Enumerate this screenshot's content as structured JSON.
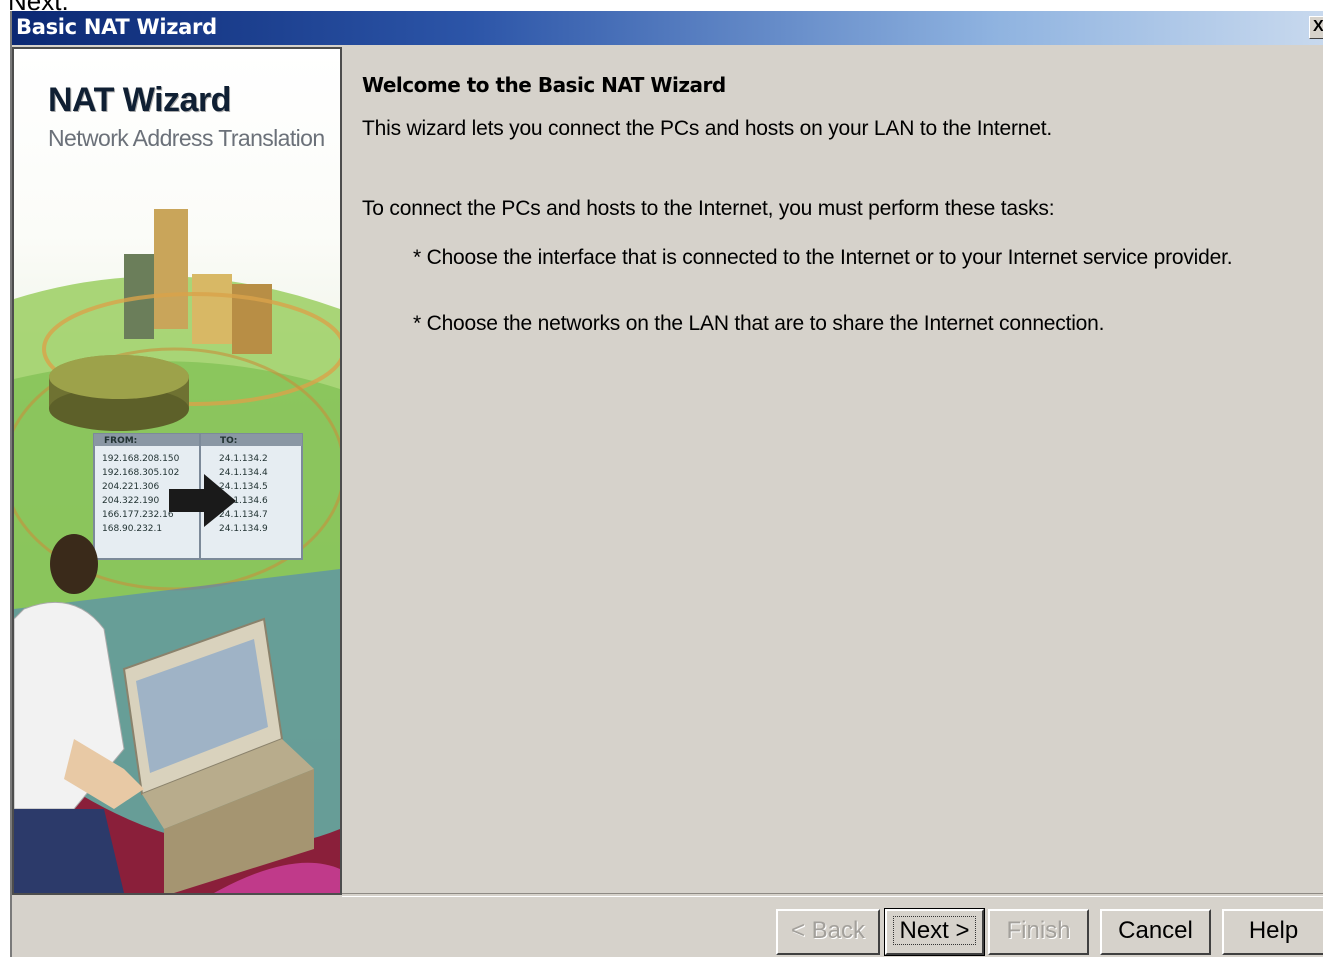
{
  "caption": "Next.",
  "window": {
    "title": "Basic NAT Wizard",
    "close_label": "X"
  },
  "side_panel": {
    "title": "NAT Wizard",
    "subtitle": "Network Address Translation",
    "illustration_table": {
      "from_header": "FROM:",
      "to_header": "TO:",
      "from": [
        "192.168.208.150",
        "192.168.305.102",
        "204.221.306",
        "204.322.190",
        "166.177.232.16",
        "168.90.232.1"
      ],
      "to": [
        "24.1.134.2",
        "24.1.134.4",
        "24.1.134.5",
        "24.1.134.6",
        "24.1.134.7",
        "24.1.134.9"
      ]
    }
  },
  "content": {
    "heading": "Welcome to the Basic NAT Wizard",
    "intro": "This wizard lets you connect the PCs and hosts on your LAN to the Internet.",
    "tasks_intro": "To connect the PCs and hosts to the Internet, you must perform these tasks:",
    "task1": "* Choose the interface that is connected to the Internet or to your Internet service provider.",
    "task2": "* Choose the networks on the LAN that are to share the Internet connection."
  },
  "buttons": {
    "back": "< Back",
    "next": "Next >",
    "finish": "Finish",
    "cancel": "Cancel",
    "help": "Help"
  }
}
